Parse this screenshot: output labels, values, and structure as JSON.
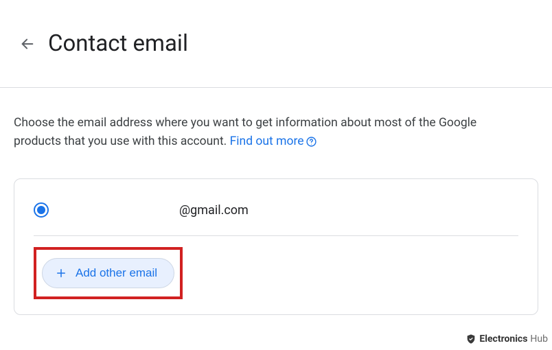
{
  "header": {
    "title": "Contact email"
  },
  "description": {
    "text_part1": "Choose the email address where you want to get information about most of the Google products that you use with this account. ",
    "link_text": "Find out more"
  },
  "email_option": {
    "value": "@gmail.com",
    "selected": true
  },
  "add_button": {
    "label": "Add other email"
  },
  "watermark": {
    "brand1": "Electronics",
    "brand2": "Hub"
  },
  "colors": {
    "accent": "#1a73e8",
    "highlight": "#d12121"
  }
}
